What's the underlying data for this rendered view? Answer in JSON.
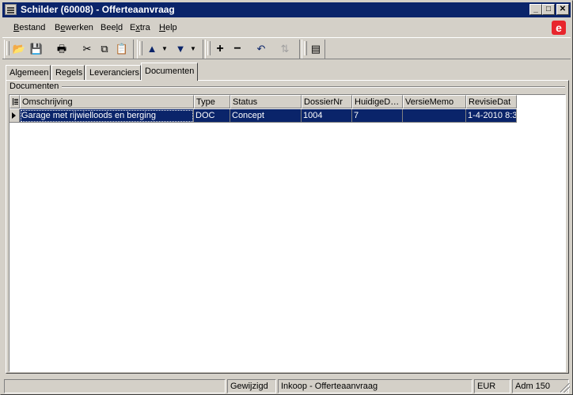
{
  "window": {
    "title": "Schilder (60008) - Offerteaanvraag"
  },
  "menu": {
    "items": [
      {
        "label": "Bestand",
        "accel": "B",
        "rest": "estand"
      },
      {
        "label": "Bewerken",
        "accel": "e",
        "pre": "B",
        "rest": "werken"
      },
      {
        "label": "Beeld",
        "accel": "l",
        "pre": "Bee",
        "rest": "d"
      },
      {
        "label": "Extra",
        "accel": "x",
        "pre": "E",
        "rest": "tra"
      },
      {
        "label": "Help",
        "accel": "H",
        "rest": "elp"
      }
    ],
    "brand": "e"
  },
  "tabs": [
    "Algemeen",
    "Regels",
    "Leveranciers",
    "Documenten"
  ],
  "active_tab": "Documenten",
  "group_label": "Documenten",
  "grid": {
    "columns": [
      "Omschrijving",
      "Type",
      "Status",
      "DossierNr",
      "HuidigeD…",
      "VersieMemo",
      "RevisieDat"
    ],
    "rows": [
      [
        "Garage met rijwielloods en berging",
        "DOC",
        "Concept",
        "1004",
        "7",
        "",
        "1-4-2010 8:3"
      ]
    ]
  },
  "status": {
    "panel1": "",
    "panel2": "Gewijzigd",
    "panel3": "Inkoop - Offerteaanvraag",
    "panel4": "EUR",
    "panel5": "Adm 150"
  }
}
